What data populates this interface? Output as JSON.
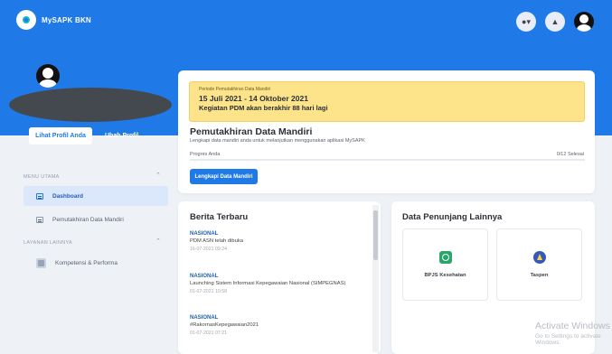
{
  "app": {
    "title": "MySAPK BKN"
  },
  "header": {
    "notif_indicator": "●▾",
    "bell": "▲"
  },
  "profile": {
    "view_label": "Lihat Profil Anda",
    "edit_label": "Ubah Profil"
  },
  "sidebar": {
    "sections": [
      {
        "label": "MENU UTAMA",
        "items": [
          {
            "label": "Dashboard",
            "active": true,
            "icon": "list-icon"
          },
          {
            "label": "Pemutakhiran Data Mandiri",
            "active": false,
            "icon": "list-icon"
          }
        ]
      },
      {
        "label": "LAYANAN LAINNYA",
        "items": [
          {
            "label": "Kompetensi & Performa",
            "active": false,
            "icon": "image-icon"
          }
        ]
      }
    ],
    "chevron": "⌃"
  },
  "notice": {
    "small": "Periode Pemutakhiran Data Mandiri",
    "dates": "15 Juli 2021 - 14 Oktober 2021",
    "warning": "Kegiatan PDM akan berakhir 88 hari lagi"
  },
  "pdm": {
    "title": "Pemutakhiran Data Mandiri",
    "subtitle": "Lengkapi data mandiri anda untuk melanjutkan menggunakan aplikasi MySAPK",
    "progress_label": "Progres Anda",
    "progress_count": "0/12 Selesai",
    "progress_fraction": 0,
    "button_label": "Lengkapi Data Mandiri"
  },
  "news": {
    "title": "Berita Terbaru",
    "items": [
      {
        "category": "NASIONAL",
        "headline": "PDM ASN telah dibuka",
        "date": "16-07-2021 09:24"
      },
      {
        "category": "NASIONAL",
        "headline": "Launching Sistem Informasi Kepegawaian Nasional (SIMPEGNAS)",
        "date": "01-07-2021 10:58"
      },
      {
        "category": "NASIONAL",
        "headline": "#RakornasKepegawaian2021",
        "date": "01-07-2021 07:21"
      }
    ]
  },
  "support": {
    "title": "Data Penunjang Lainnya",
    "tiles": [
      {
        "label": "BPJS Kesehatan",
        "icon": "bpjs-icon"
      },
      {
        "label": "Taspen",
        "icon": "taspen-icon"
      }
    ]
  },
  "watermark": {
    "title": "Activate Windows",
    "subtitle": "Go to Settings to activate Windows."
  },
  "colors": {
    "primary": "#1f7ae8",
    "notice_bg": "#fde48a",
    "background": "#eef1f5"
  }
}
